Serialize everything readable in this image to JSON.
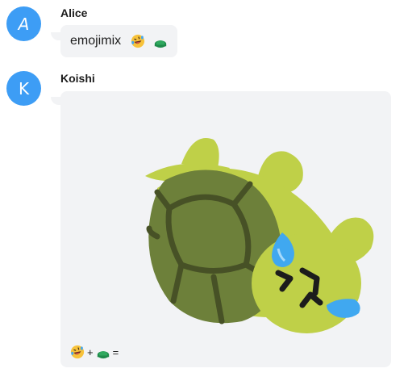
{
  "messages": [
    {
      "sender": "Alice",
      "avatar_letter": "A",
      "text": "emojimix",
      "emojis": [
        "rolling-on-the-floor-laughing",
        "turtle"
      ]
    },
    {
      "sender": "Koishi",
      "avatar_letter": "K",
      "image": {
        "description_icon": "laughing-turtle-sticker",
        "caption_plus": "+",
        "caption_equals": "="
      }
    }
  ],
  "colors": {
    "avatar": "#3d9df5",
    "bubble": "#f2f3f5",
    "turtle_body": "#bfd048",
    "turtle_shell": "#6d803a",
    "shell_lines": "#475126",
    "tear": "#40a8f0"
  }
}
